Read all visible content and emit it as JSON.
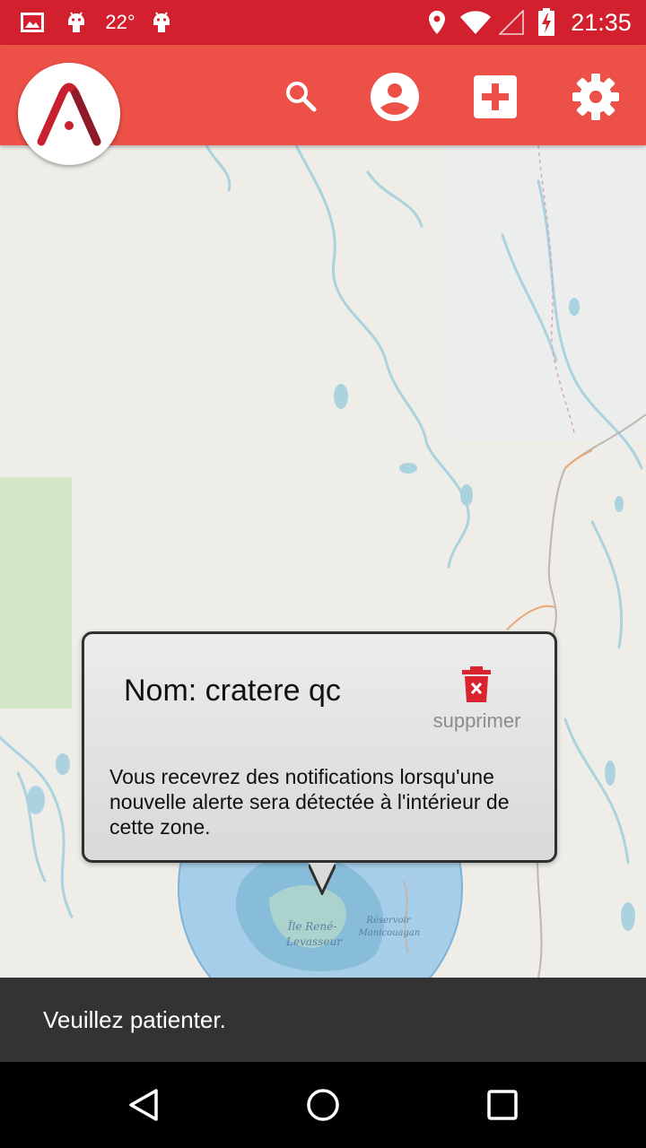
{
  "status_bar": {
    "temperature": "22°",
    "time": "21:35",
    "icons": [
      "gallery-icon",
      "android-icon",
      "android-icon",
      "location-icon",
      "wifi-icon",
      "signal-icon",
      "battery-charging-icon"
    ]
  },
  "app_bar": {
    "logo": "app-logo",
    "actions": [
      "search-icon",
      "account-icon",
      "add-box-icon",
      "settings-icon"
    ],
    "color": "#ec5047"
  },
  "map": {
    "labels": {
      "island": "Île René-\nLevasseur",
      "island_line1": "Île René-",
      "island_line2": "Levasseur",
      "reservoir_line1": "Réservoir",
      "reservoir_line2": "Manicouagan"
    }
  },
  "popup": {
    "title": "Nom: cratere qc",
    "delete_label": "supprimer",
    "message": "Vous recevrez des notifications lorsqu'une nouvelle alerte sera détectée à l'intérieur de cette zone."
  },
  "snackbar": {
    "message": "Veuillez patienter."
  },
  "nav_bar": {
    "buttons": [
      "back-icon",
      "home-icon",
      "recents-icon"
    ]
  },
  "colors": {
    "status_bar": "#d2202f",
    "accent": "#ec5047",
    "water": "#aad3df",
    "zone": "#8fc3ea"
  }
}
